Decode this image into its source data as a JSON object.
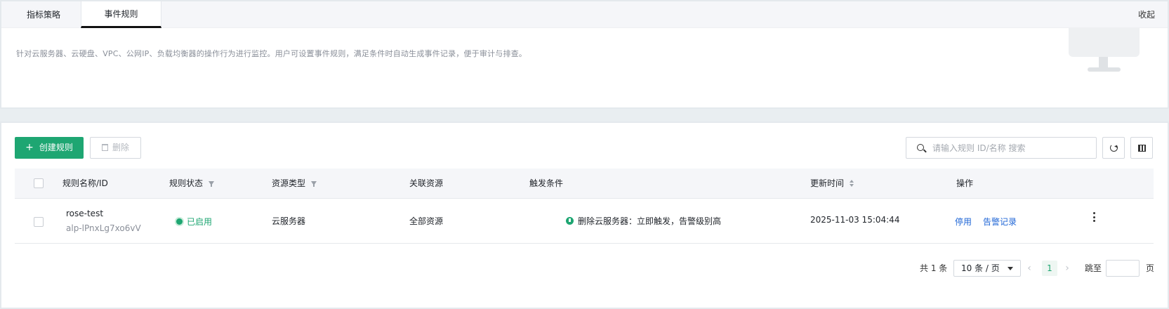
{
  "tabs": [
    {
      "label": "指标策略"
    },
    {
      "label": "事件规则"
    }
  ],
  "collapse_label": "收起",
  "description": "针对云服务器、云硬盘、VPC、公网IP、负载均衡器的操作行为进行监控。用户可设置事件规则，满足条件时自动生成事件记录，便于审计与排查。",
  "toolbar": {
    "create_label": "创建规则",
    "delete_label": "删除",
    "search_placeholder": "请输入规则 ID/名称 搜索"
  },
  "table": {
    "columns": [
      "规则名称/ID",
      "规则状态",
      "资源类型",
      "关联资源",
      "触发条件",
      "更新时间",
      "操作"
    ],
    "rows": [
      {
        "name": "rose-test",
        "id": "alp-lPnxLg7xo6vV",
        "status": "已启用",
        "resource_type": "云服务器",
        "related_resource": "全部资源",
        "trigger": "删除云服务器：立即触发，告警级别高",
        "updated_at": "2025-11-03 15:04:44",
        "actions": [
          "停用",
          "告警记录"
        ]
      }
    ]
  },
  "pagination": {
    "total_label": "共 1 条",
    "page_size": "10 条 / 页",
    "current_page": "1",
    "jump_label": "跳至",
    "page_suffix": "页"
  },
  "colors": {
    "primary": "#1ea672",
    "link": "#1f66d6"
  }
}
